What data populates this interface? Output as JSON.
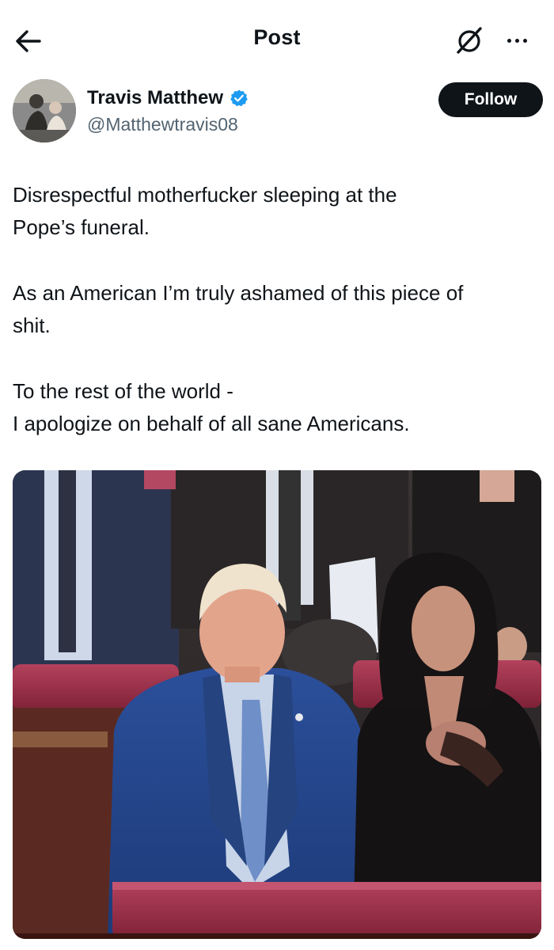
{
  "header": {
    "title": "Post",
    "back_icon": "arrow-left-icon",
    "grok_icon": "grok-icon",
    "more_icon": "more-horizontal-icon"
  },
  "author": {
    "display_name": "Travis Matthew",
    "handle": "@Matthewtravis08",
    "verified": true,
    "verified_color": "#1d9bf0",
    "follow_label": "Follow"
  },
  "post": {
    "paragraphs": [
      [
        "Disrespectful motherfucker sleeping at the",
        "Pope’s funeral."
      ],
      [
        "As an American I’m truly ashamed of this piece of",
        "shit."
      ],
      [
        "To the rest of the world -",
        "I apologize on behalf of all sane Americans."
      ]
    ]
  },
  "media": {
    "type": "photo"
  },
  "colors": {
    "text": "#0f1419",
    "secondary": "#536471",
    "button_bg": "#0f1419",
    "button_text": "#ffffff"
  }
}
